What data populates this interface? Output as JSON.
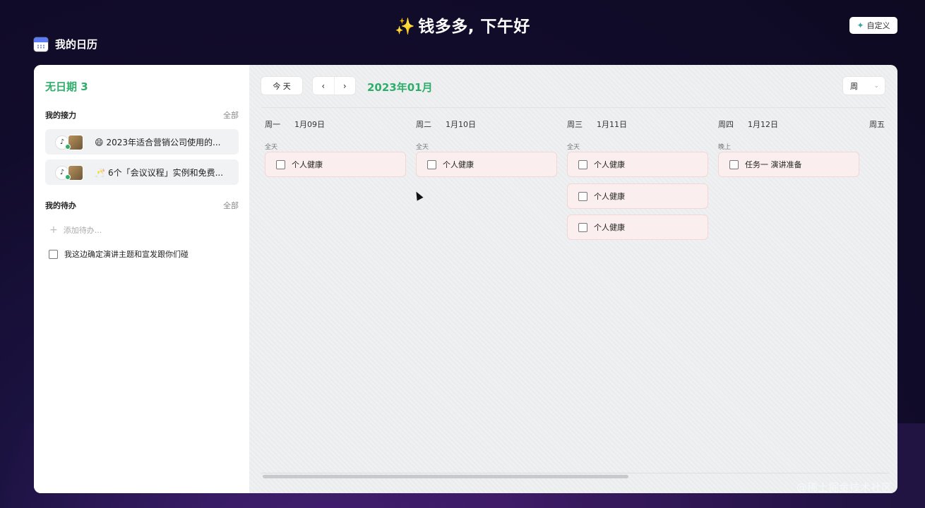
{
  "header": {
    "greeting_emoji": "✨",
    "greeting": "钱多多, 下午好",
    "app_title": "我的日历",
    "customize_label": "自定义"
  },
  "sidebar": {
    "no_date": "无日期 3",
    "relay": {
      "title": "我的接力",
      "all": "全部",
      "items": [
        {
          "emoji": "😄",
          "text": "2023年适合营销公司使用的..."
        },
        {
          "emoji": "🥂",
          "text": "6个「会议议程」实例和免费..."
        }
      ]
    },
    "todo": {
      "title": "我的待办",
      "all": "全部",
      "add_placeholder": "添加待办...",
      "items": [
        {
          "text": "我这边确定演讲主题和宣发跟你们碰",
          "checked": false
        }
      ]
    }
  },
  "calendar": {
    "today_label": "今 天",
    "prev_label": "‹",
    "next_label": "›",
    "month_label": "2023年01月",
    "view_select": "周",
    "days": [
      {
        "weekday": "周一",
        "date": "1月09日",
        "slot": "全天",
        "events": [
          "个人健康"
        ]
      },
      {
        "weekday": "周二",
        "date": "1月10日",
        "slot": "全天",
        "events": [
          "个人健康"
        ]
      },
      {
        "weekday": "周三",
        "date": "1月11日",
        "slot": "全天",
        "events": [
          "个人健康",
          "个人健康",
          "个人健康"
        ]
      },
      {
        "weekday": "周四",
        "date": "1月12日",
        "slot": "晚上",
        "events": [
          "任务一 演讲准备"
        ]
      },
      {
        "weekday": "周五",
        "date": "",
        "slot": "",
        "events": []
      }
    ]
  },
  "watermark": "@稀土掘金技术社区",
  "colors": {
    "accent_green": "#2fae6b",
    "event_bg": "#fbeeee"
  }
}
